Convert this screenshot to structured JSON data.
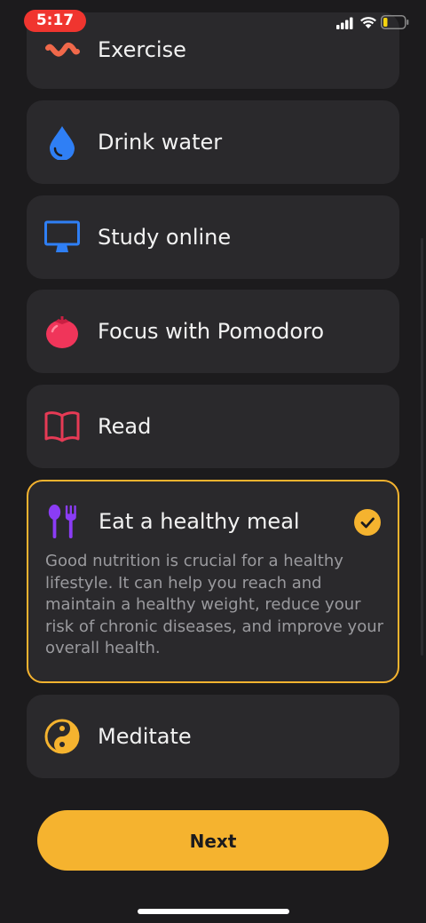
{
  "status_bar": {
    "time": "5:17",
    "accent": "#f0352f"
  },
  "habits": [
    {
      "label": "Exercise",
      "icon": "exercise-squiggle-icon",
      "color": "#f0684a"
    },
    {
      "label": "Drink water",
      "icon": "water-drop-icon",
      "color": "#2f7ff5"
    },
    {
      "label": "Study online",
      "icon": "monitor-icon",
      "color": "#2f7ff5"
    },
    {
      "label": "Focus with Pomodoro",
      "icon": "tomato-icon",
      "color": "#f0355a"
    },
    {
      "label": "Read",
      "icon": "open-book-icon",
      "color": "#e63a55"
    },
    {
      "label": "Eat a healthy meal",
      "icon": "spoon-fork-icon",
      "color": "#8b3cf5",
      "selected": true,
      "description": "Good nutrition is crucial for a healthy lifestyle. It can help you reach and maintain a healthy weight, reduce your risk of chronic diseases, and improve your overall health."
    },
    {
      "label": "Meditate",
      "icon": "yin-yang-icon",
      "color": "#f5b32f"
    }
  ],
  "next_button": {
    "label": "Next"
  },
  "colors": {
    "background": "#1c1b1d",
    "card": "#2a292c",
    "accent": "#f5b32f"
  }
}
